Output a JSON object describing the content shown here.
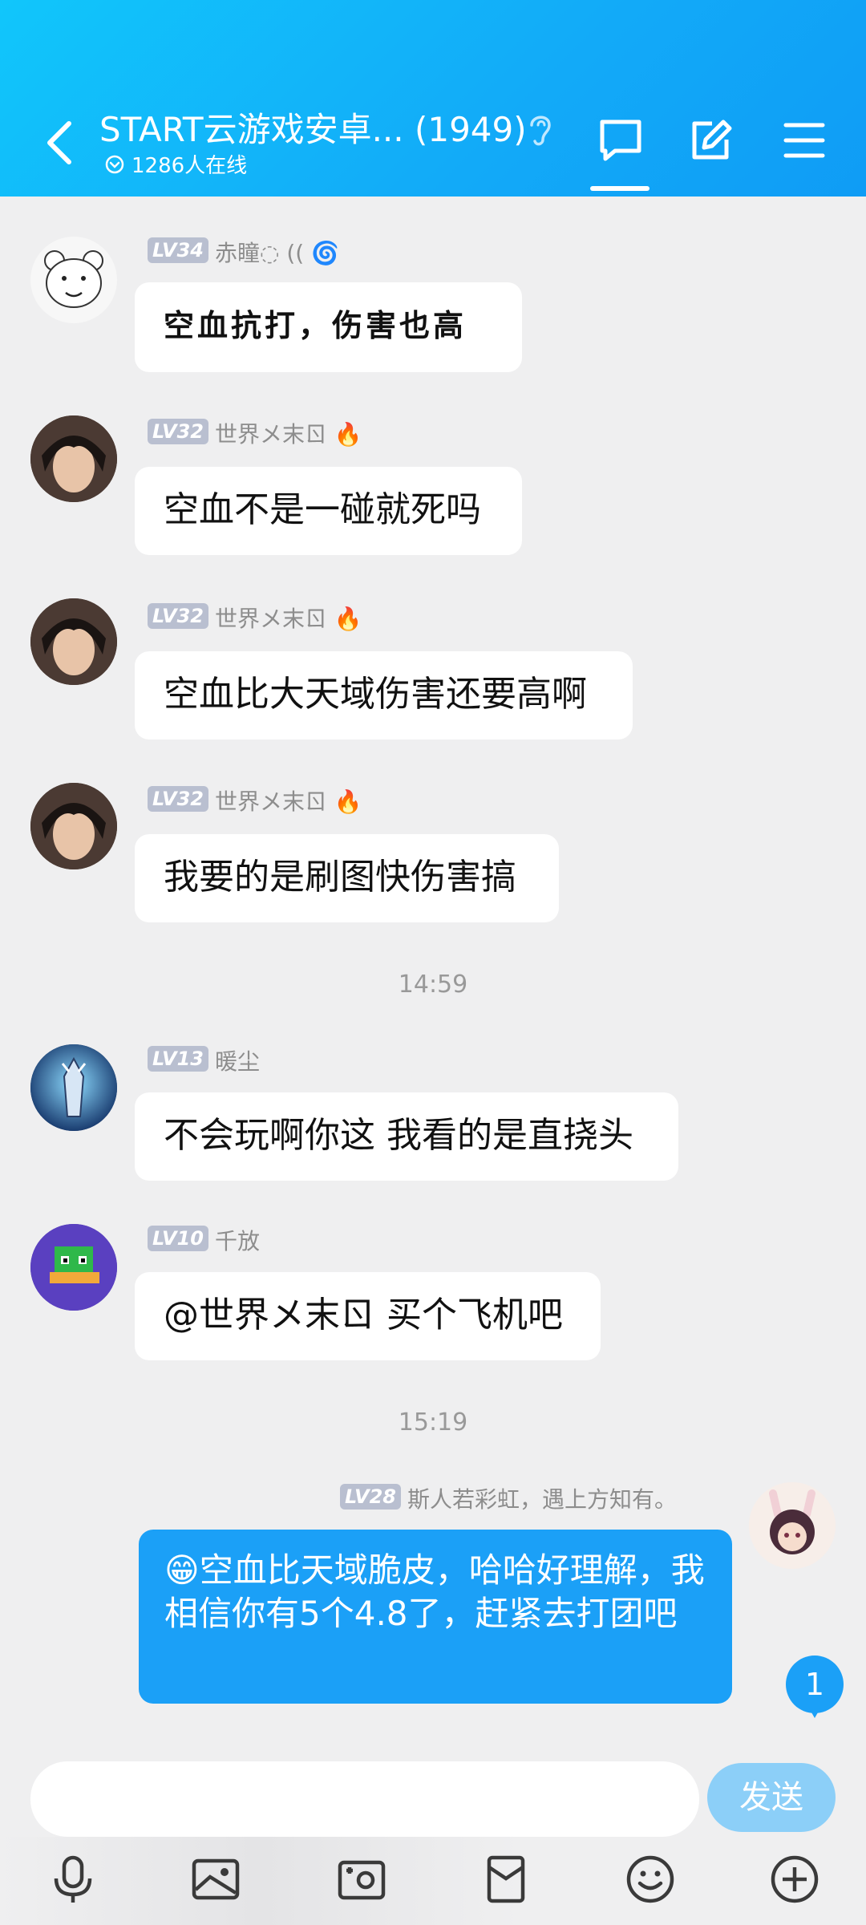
{
  "header": {
    "title": "START云游戏安卓... (1949)",
    "online": "1286人在线",
    "icons": [
      "back-icon",
      "ear-icon",
      "chat-icon",
      "edit-icon",
      "menu-icon"
    ]
  },
  "messages": [
    {
      "level": "LV34",
      "nick": "赤瞳◌ (( 🌀",
      "text": "空血抗打，伤害也高"
    },
    {
      "level": "LV32",
      "nick": "世界メ末ㄖ 🔥",
      "text": "空血不是一碰就死吗"
    },
    {
      "level": "LV32",
      "nick": "世界メ末ㄖ 🔥",
      "text": "空血比大天域伤害还要高啊"
    },
    {
      "level": "LV32",
      "nick": "世界メ末ㄖ 🔥",
      "text": "我要的是刷图快伤害搞"
    },
    {
      "level": "LV13",
      "nick": "暖尘",
      "text": "不会玩啊你这 我看的是直挠头"
    },
    {
      "level": "LV10",
      "nick": "千放",
      "text": "@世界メ末ㄖ 买个飞机吧"
    },
    {
      "level": "LV28",
      "nick": "斯人若彩虹，遇上方知有。",
      "text": "😁空血比天域脆皮，哈哈好理解，我相信你有5个4.8了，赶紧去打团吧"
    }
  ],
  "times": [
    "14:59",
    "15:19"
  ],
  "badge": "1",
  "input": {
    "placeholder": "",
    "send_label": "发送"
  },
  "colors": {
    "accent": "#1ba0f7",
    "header": "#12aaf8"
  }
}
